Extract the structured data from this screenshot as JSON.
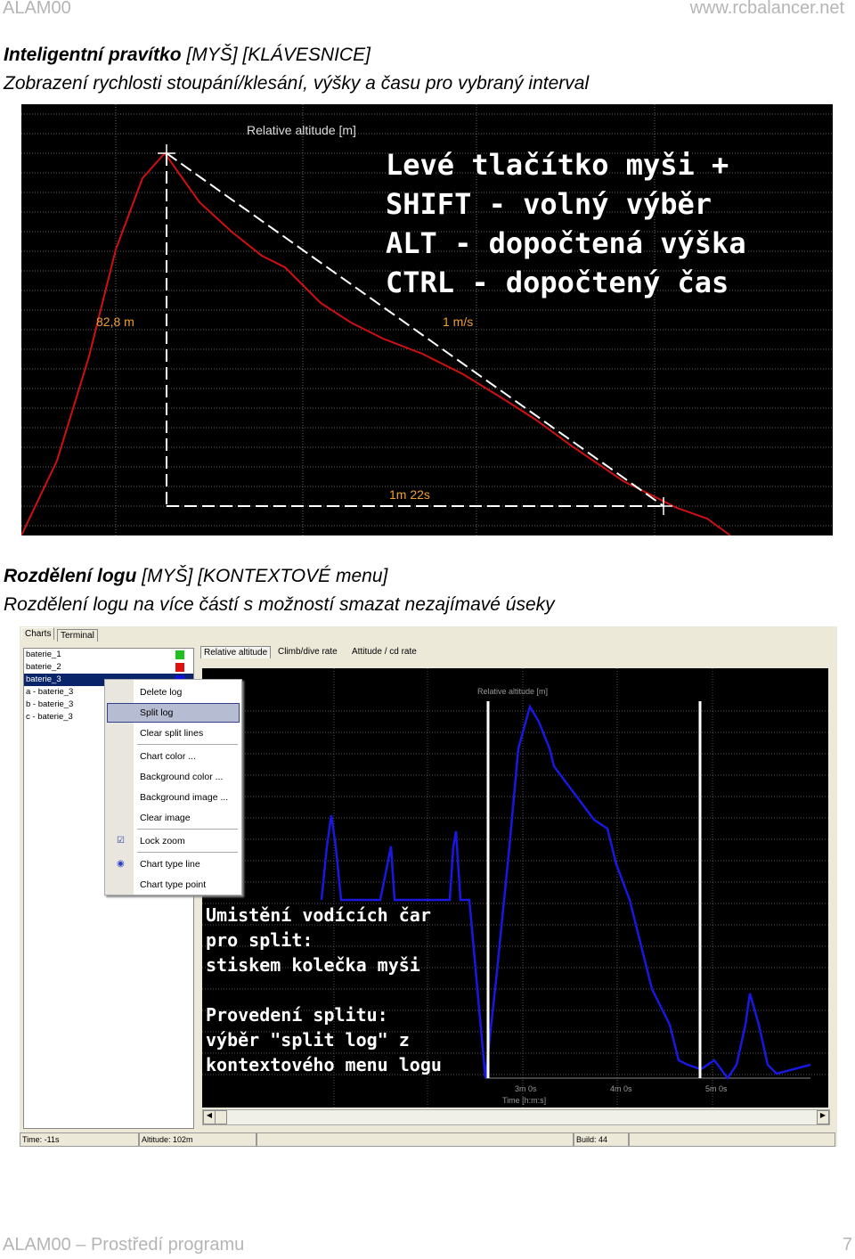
{
  "header": {
    "left": "ALAM00",
    "right": "www.rcbalancer.net"
  },
  "section1": {
    "title_bold": "Inteligentní pravítko",
    "title_rest": " [MYŠ] [KLÁVESNICE]",
    "subtitle": "Zobrazení rychlosti stoupání/klesání, výšky a času pro vybraný interval"
  },
  "chart1": {
    "title": "Relative altitude [m]",
    "height_label": "82,8 m",
    "rate_label": "1 m/s",
    "time_label": "1m 22s",
    "overlay": [
      "Levé tlačítko myši +",
      "SHIFT - volný výběr",
      "ALT - dopočtená výška",
      "CTRL - dopočtený čas"
    ],
    "line_color": "#d01010"
  },
  "section2": {
    "title_bold": "Rozdělení logu",
    "title_rest": " [MYŠ] [KONTEXTOVÉ menu]",
    "subtitle": "Rozdělení logu na více částí s možností smazat nezajímavé úseky"
  },
  "app": {
    "tabs": [
      "Charts",
      "Terminal"
    ],
    "logs": [
      {
        "name": "baterie_1",
        "color": "#20c020"
      },
      {
        "name": "baterie_2",
        "color": "#e01010"
      },
      {
        "name": "baterie_3",
        "color": "#1010e0",
        "selected": true
      },
      {
        "name": "a - baterie_3"
      },
      {
        "name": "b - baterie_3"
      },
      {
        "name": "c - baterie_3"
      }
    ],
    "chart_tabs": [
      "Relative altitude",
      "Climb/dive rate",
      "Attitude / cd rate"
    ],
    "context_menu": [
      "Delete log",
      "Split log",
      "Clear split lines",
      "Chart color ...",
      "Background color ...",
      "Background image ...",
      "Clear image",
      "Lock zoom",
      "Chart type line",
      "Chart type point"
    ],
    "highlighted_menu_item": "Split log",
    "chart_title": "Relative altitude [m]",
    "x_ticks": [
      "3m 0s",
      "4m 0s",
      "5m 0s"
    ],
    "x_label": "Time [h:m:s]",
    "overlay": [
      "Umistění vodících čar",
      "pro split:",
      "stiskem kolečka myši",
      "",
      "Provedení splitu:",
      "výběr \"split log\" z",
      "kontextového menu logu"
    ],
    "status": {
      "time": "Time: -11s",
      "altitude": "Altitude: 102m",
      "build": "Build: 44"
    }
  },
  "footer": {
    "left": "ALAM00 – Prostředí programu",
    "page": "7"
  }
}
